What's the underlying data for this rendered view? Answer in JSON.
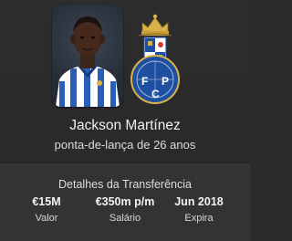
{
  "player": {
    "name": "Jackson Martínez",
    "subtitle": "ponta-de-lança de 26 anos"
  },
  "club": {
    "crest_icon": "fc-porto-crest-icon",
    "crest_letters": "F C P",
    "colors": {
      "blue": "#1f4fa0",
      "gold": "#d8b14a",
      "white": "#ffffff"
    }
  },
  "transfer": {
    "title": "Detalhes da Transferência",
    "stats": [
      {
        "value": "€15M",
        "label": "Valor"
      },
      {
        "value": "€350m p/m",
        "label": "Salário"
      },
      {
        "value": "Jun 2018",
        "label": "Expira"
      }
    ]
  }
}
